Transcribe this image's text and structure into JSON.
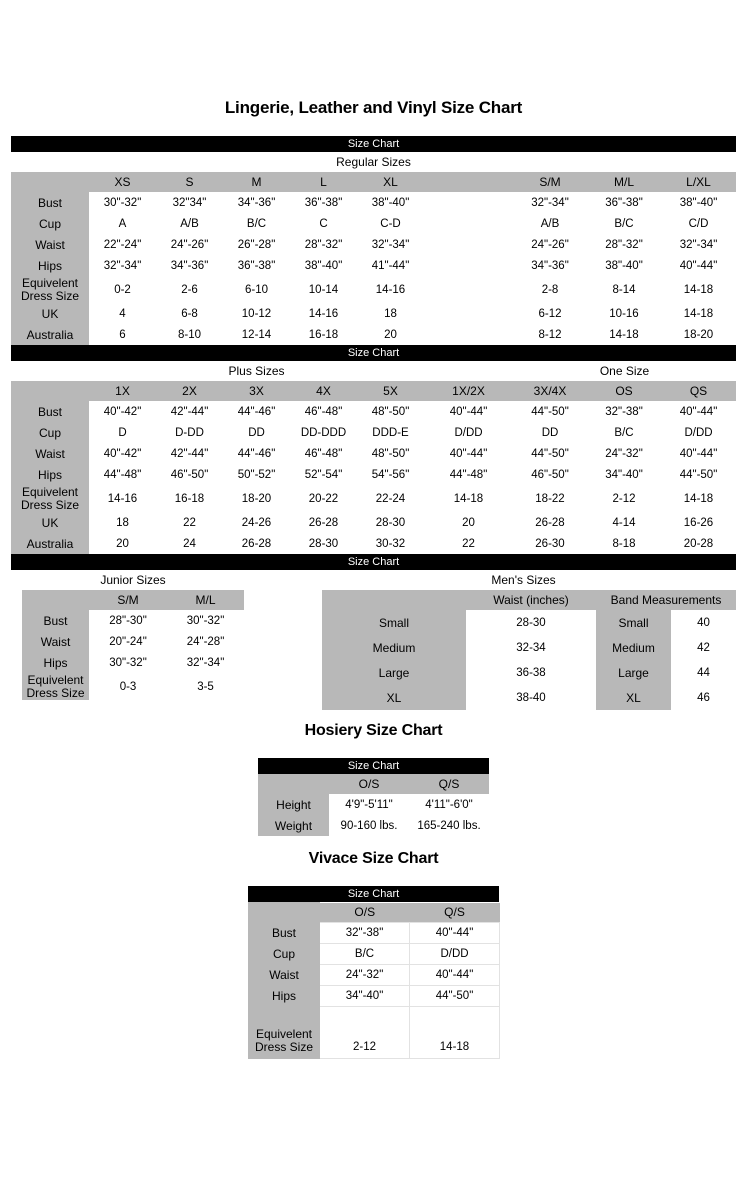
{
  "page": {
    "main_title": "Lingerie, Leather and Vinyl Size Chart",
    "hosiery_title": "Hosiery Size Chart",
    "vivace_title": "Vivace Size Chart",
    "bar_label": "Size Chart",
    "colors": {
      "bar_background": "#000000",
      "bar_text": "#ffffff",
      "label_background": "#b8b8b8",
      "label_text": "#ffffff",
      "value_text": "#000000",
      "page_background": "#ffffff"
    }
  },
  "regular": {
    "bar": "Size Chart",
    "group_title": "Regular Sizes",
    "columns": [
      "XS",
      "S",
      "M",
      "L",
      "XL",
      "",
      "S/M",
      "M/L",
      "L/XL"
    ],
    "rows": [
      {
        "label": "Bust",
        "values": [
          "30\"-32\"",
          "32\"34\"",
          "34\"-36\"",
          "36\"-38\"",
          "38\"-40\"",
          "",
          "32\"-34\"",
          "36\"-38\"",
          "38\"-40\""
        ]
      },
      {
        "label": "Cup",
        "values": [
          "A",
          "A/B",
          "B/C",
          "C",
          "C-D",
          "",
          "A/B",
          "B/C",
          "C/D"
        ]
      },
      {
        "label": "Waist",
        "values": [
          "22\"-24\"",
          "24\"-26\"",
          "26\"-28\"",
          "28\"-32\"",
          "32\"-34\"",
          "",
          "24\"-26\"",
          "28\"-32\"",
          "32\"-34\""
        ]
      },
      {
        "label": "Hips",
        "values": [
          "32\"-34\"",
          "34\"-36\"",
          "36\"-38\"",
          "38\"-40\"",
          "41\"-44\"",
          "",
          "34\"-36\"",
          "38\"-40\"",
          "40\"-44\""
        ]
      },
      {
        "label_line1": "Equivelent",
        "label_line2": "Dress Size",
        "label": "Equivelent Dress Size",
        "values": [
          "0-2",
          "2-6",
          "6-10",
          "10-14",
          "14-16",
          "",
          "2-8",
          "8-14",
          "14-18"
        ]
      },
      {
        "label": "UK",
        "values": [
          "4",
          "6-8",
          "10-12",
          "14-16",
          "18",
          "",
          "6-12",
          "10-16",
          "14-18"
        ]
      },
      {
        "label": "Australia",
        "values": [
          "6",
          "8-10",
          "12-14",
          "16-18",
          "20",
          "",
          "8-12",
          "14-18",
          "18-20"
        ]
      }
    ]
  },
  "plus": {
    "bar": "Size Chart",
    "group_title": "Plus Sizes",
    "group_title_right": "One Size",
    "columns": [
      "1X",
      "2X",
      "3X",
      "4X",
      "5X",
      "1X/2X",
      "3X/4X",
      "OS",
      "QS"
    ],
    "rows": [
      {
        "label": "Bust",
        "values": [
          "40\"-42\"",
          "42\"-44\"",
          "44\"-46\"",
          "46\"-48\"",
          "48\"-50\"",
          "40\"-44\"",
          "44\"-50\"",
          "32\"-38\"",
          "40\"-44\""
        ]
      },
      {
        "label": "Cup",
        "values": [
          "D",
          "D-DD",
          "DD",
          "DD-DDD",
          "DDD-E",
          "D/DD",
          "DD",
          "B/C",
          "D/DD"
        ]
      },
      {
        "label": "Waist",
        "values": [
          "40\"-42\"",
          "42\"-44\"",
          "44\"-46\"",
          "46\"-48\"",
          "48\"-50\"",
          "40\"-44\"",
          "44\"-50\"",
          "24\"-32\"",
          "40\"-44\""
        ]
      },
      {
        "label": "Hips",
        "values": [
          "44\"-48\"",
          "46\"-50\"",
          "50\"-52\"",
          "52\"-54\"",
          "54\"-56\"",
          "44\"-48\"",
          "46\"-50\"",
          "34\"-40\"",
          "44\"-50\""
        ]
      },
      {
        "label_line1": "Equivelent",
        "label_line2": "Dress Size",
        "label": "Equivelent Dress Size",
        "values": [
          "14-16",
          "16-18",
          "18-20",
          "20-22",
          "22-24",
          "14-18",
          "18-22",
          "2-12",
          "14-18"
        ]
      },
      {
        "label": "UK",
        "values": [
          "18",
          "22",
          "24-26",
          "26-28",
          "28-30",
          "20",
          "26-28",
          "4-14",
          "16-26"
        ]
      },
      {
        "label": "Australia",
        "values": [
          "20",
          "24",
          "26-28",
          "28-30",
          "30-32",
          "22",
          "26-30",
          "8-18",
          "20-28"
        ]
      }
    ]
  },
  "junior_mens": {
    "bar": "Size Chart",
    "junior": {
      "group_title": "Junior Sizes",
      "columns": [
        "S/M",
        "M/L"
      ],
      "rows": [
        {
          "label": "Bust",
          "values": [
            "28\"-30\"",
            "30\"-32\""
          ]
        },
        {
          "label": "Waist",
          "values": [
            "20\"-24\"",
            "24\"-28\""
          ]
        },
        {
          "label": "Hips",
          "values": [
            "30\"-32\"",
            "32\"-34\""
          ]
        },
        {
          "label_line1": "Equivelent",
          "label_line2": "Dress Size",
          "label": "Equivelent Dress Size",
          "values": [
            "0-3",
            "3-5"
          ]
        }
      ]
    },
    "mens": {
      "group_title": "Men's Sizes",
      "waist_header": "Waist (inches)",
      "band_header": "Band Measurements",
      "rows": [
        {
          "label": "Small",
          "waist": "28-30",
          "band_label": "Small",
          "band": "40"
        },
        {
          "label": "Medium",
          "waist": "32-34",
          "band_label": "Medium",
          "band": "42"
        },
        {
          "label": "Large",
          "waist": "36-38",
          "band_label": "Large",
          "band": "44"
        },
        {
          "label": "XL",
          "waist": "38-40",
          "band_label": "XL",
          "band": "46"
        }
      ]
    }
  },
  "hosiery": {
    "title": "Hosiery Size Chart",
    "bar": "Size Chart",
    "columns": [
      "O/S",
      "Q/S"
    ],
    "rows": [
      {
        "label": "Height",
        "values": [
          "4'9\"-5'11\"",
          "4'11\"-6'0\""
        ]
      },
      {
        "label": "Weight",
        "values": [
          "90-160 lbs.",
          "165-240 lbs."
        ]
      }
    ]
  },
  "vivace": {
    "title": "Vivace Size Chart",
    "bar": "Size Chart",
    "columns": [
      "O/S",
      "Q/S"
    ],
    "rows": [
      {
        "label": "Bust",
        "values": [
          "32\"-38\"",
          "40\"-44\""
        ]
      },
      {
        "label": "Cup",
        "values": [
          "B/C",
          "D/DD"
        ]
      },
      {
        "label": "Waist",
        "values": [
          "24\"-32\"",
          "40\"-44\""
        ]
      },
      {
        "label": "Hips",
        "values": [
          "34\"-40\"",
          "44\"-50\""
        ]
      },
      {
        "label_line1": "Equivelent",
        "label_line2": "Dress Size",
        "label": "Equivelent Dress Size",
        "values": [
          "2-12",
          "14-18"
        ]
      }
    ]
  }
}
